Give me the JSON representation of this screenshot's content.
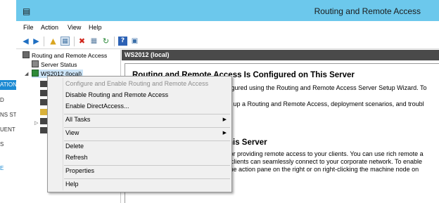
{
  "background_app": {
    "items": [
      "ATION",
      "D",
      "NS STA",
      "UENT",
      "S",
      "E"
    ]
  },
  "window": {
    "title": "Routing and Remote Access",
    "app_icon": "server-icon",
    "title_bar_color": "#6cc8ec"
  },
  "menubar": {
    "items": [
      "File",
      "Action",
      "View",
      "Help"
    ]
  },
  "toolbar": {
    "icons": [
      "back-arrow-icon",
      "forward-arrow-icon",
      "folder-up-icon",
      "show-hide-console-tree-icon",
      "delete-icon",
      "properties-icon",
      "refresh-icon",
      "help-icon",
      "mmc-icon"
    ]
  },
  "tree": {
    "root": "Routing and Remote Access",
    "server_status": "Server Status",
    "server": "WS2012 (local)"
  },
  "result_pane": {
    "header": "WS2012 (local)",
    "heading": "Routing and Remote Access Is Configured on This Server",
    "line1": "figured using the Routing and Remote Access Server Setup Wizard. To",
    "line2": "g up a Routing and Remote Access, deployment scenarios, and troubl",
    "heading2": "his Server",
    "para1": "for providing remote access to your clients. You can use rich remote a",
    "para2": "clients can seamlessly connect to your corporate network. To enable",
    "para3": "the action pane on the right or on right-clicking the machine node on"
  },
  "context_menu": {
    "items": [
      {
        "label": "Configure and Enable Routing and Remote Access",
        "enabled": false
      },
      {
        "label": "Disable Routing and Remote Access",
        "enabled": true
      },
      {
        "label": "Enable DirectAccess...",
        "enabled": true
      },
      {
        "label": "All Tasks",
        "enabled": true,
        "submenu": true
      },
      {
        "label": "View",
        "enabled": true,
        "submenu": true
      },
      {
        "label": "Delete",
        "enabled": true
      },
      {
        "label": "Refresh",
        "enabled": true
      },
      {
        "label": "Properties",
        "enabled": true
      },
      {
        "label": "Help",
        "enabled": true
      }
    ]
  }
}
